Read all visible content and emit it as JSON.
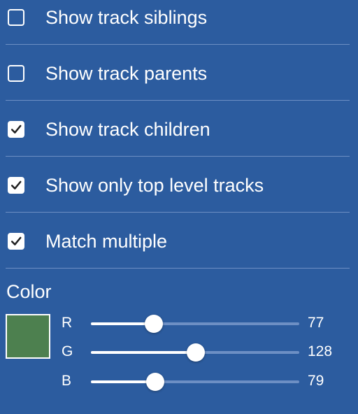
{
  "options": [
    {
      "label": "Show track siblings",
      "checked": false
    },
    {
      "label": "Show track parents",
      "checked": false
    },
    {
      "label": "Show track children",
      "checked": true
    },
    {
      "label": "Show only top level tracks",
      "checked": true
    },
    {
      "label": "Match multiple",
      "checked": true
    }
  ],
  "color": {
    "title": "Color",
    "swatch_hex": "#4d804f",
    "channels": [
      {
        "label": "R",
        "value": "77",
        "fraction": 0.302
      },
      {
        "label": "G",
        "value": "128",
        "fraction": 0.502
      },
      {
        "label": "B",
        "value": "79",
        "fraction": 0.31
      }
    ]
  }
}
